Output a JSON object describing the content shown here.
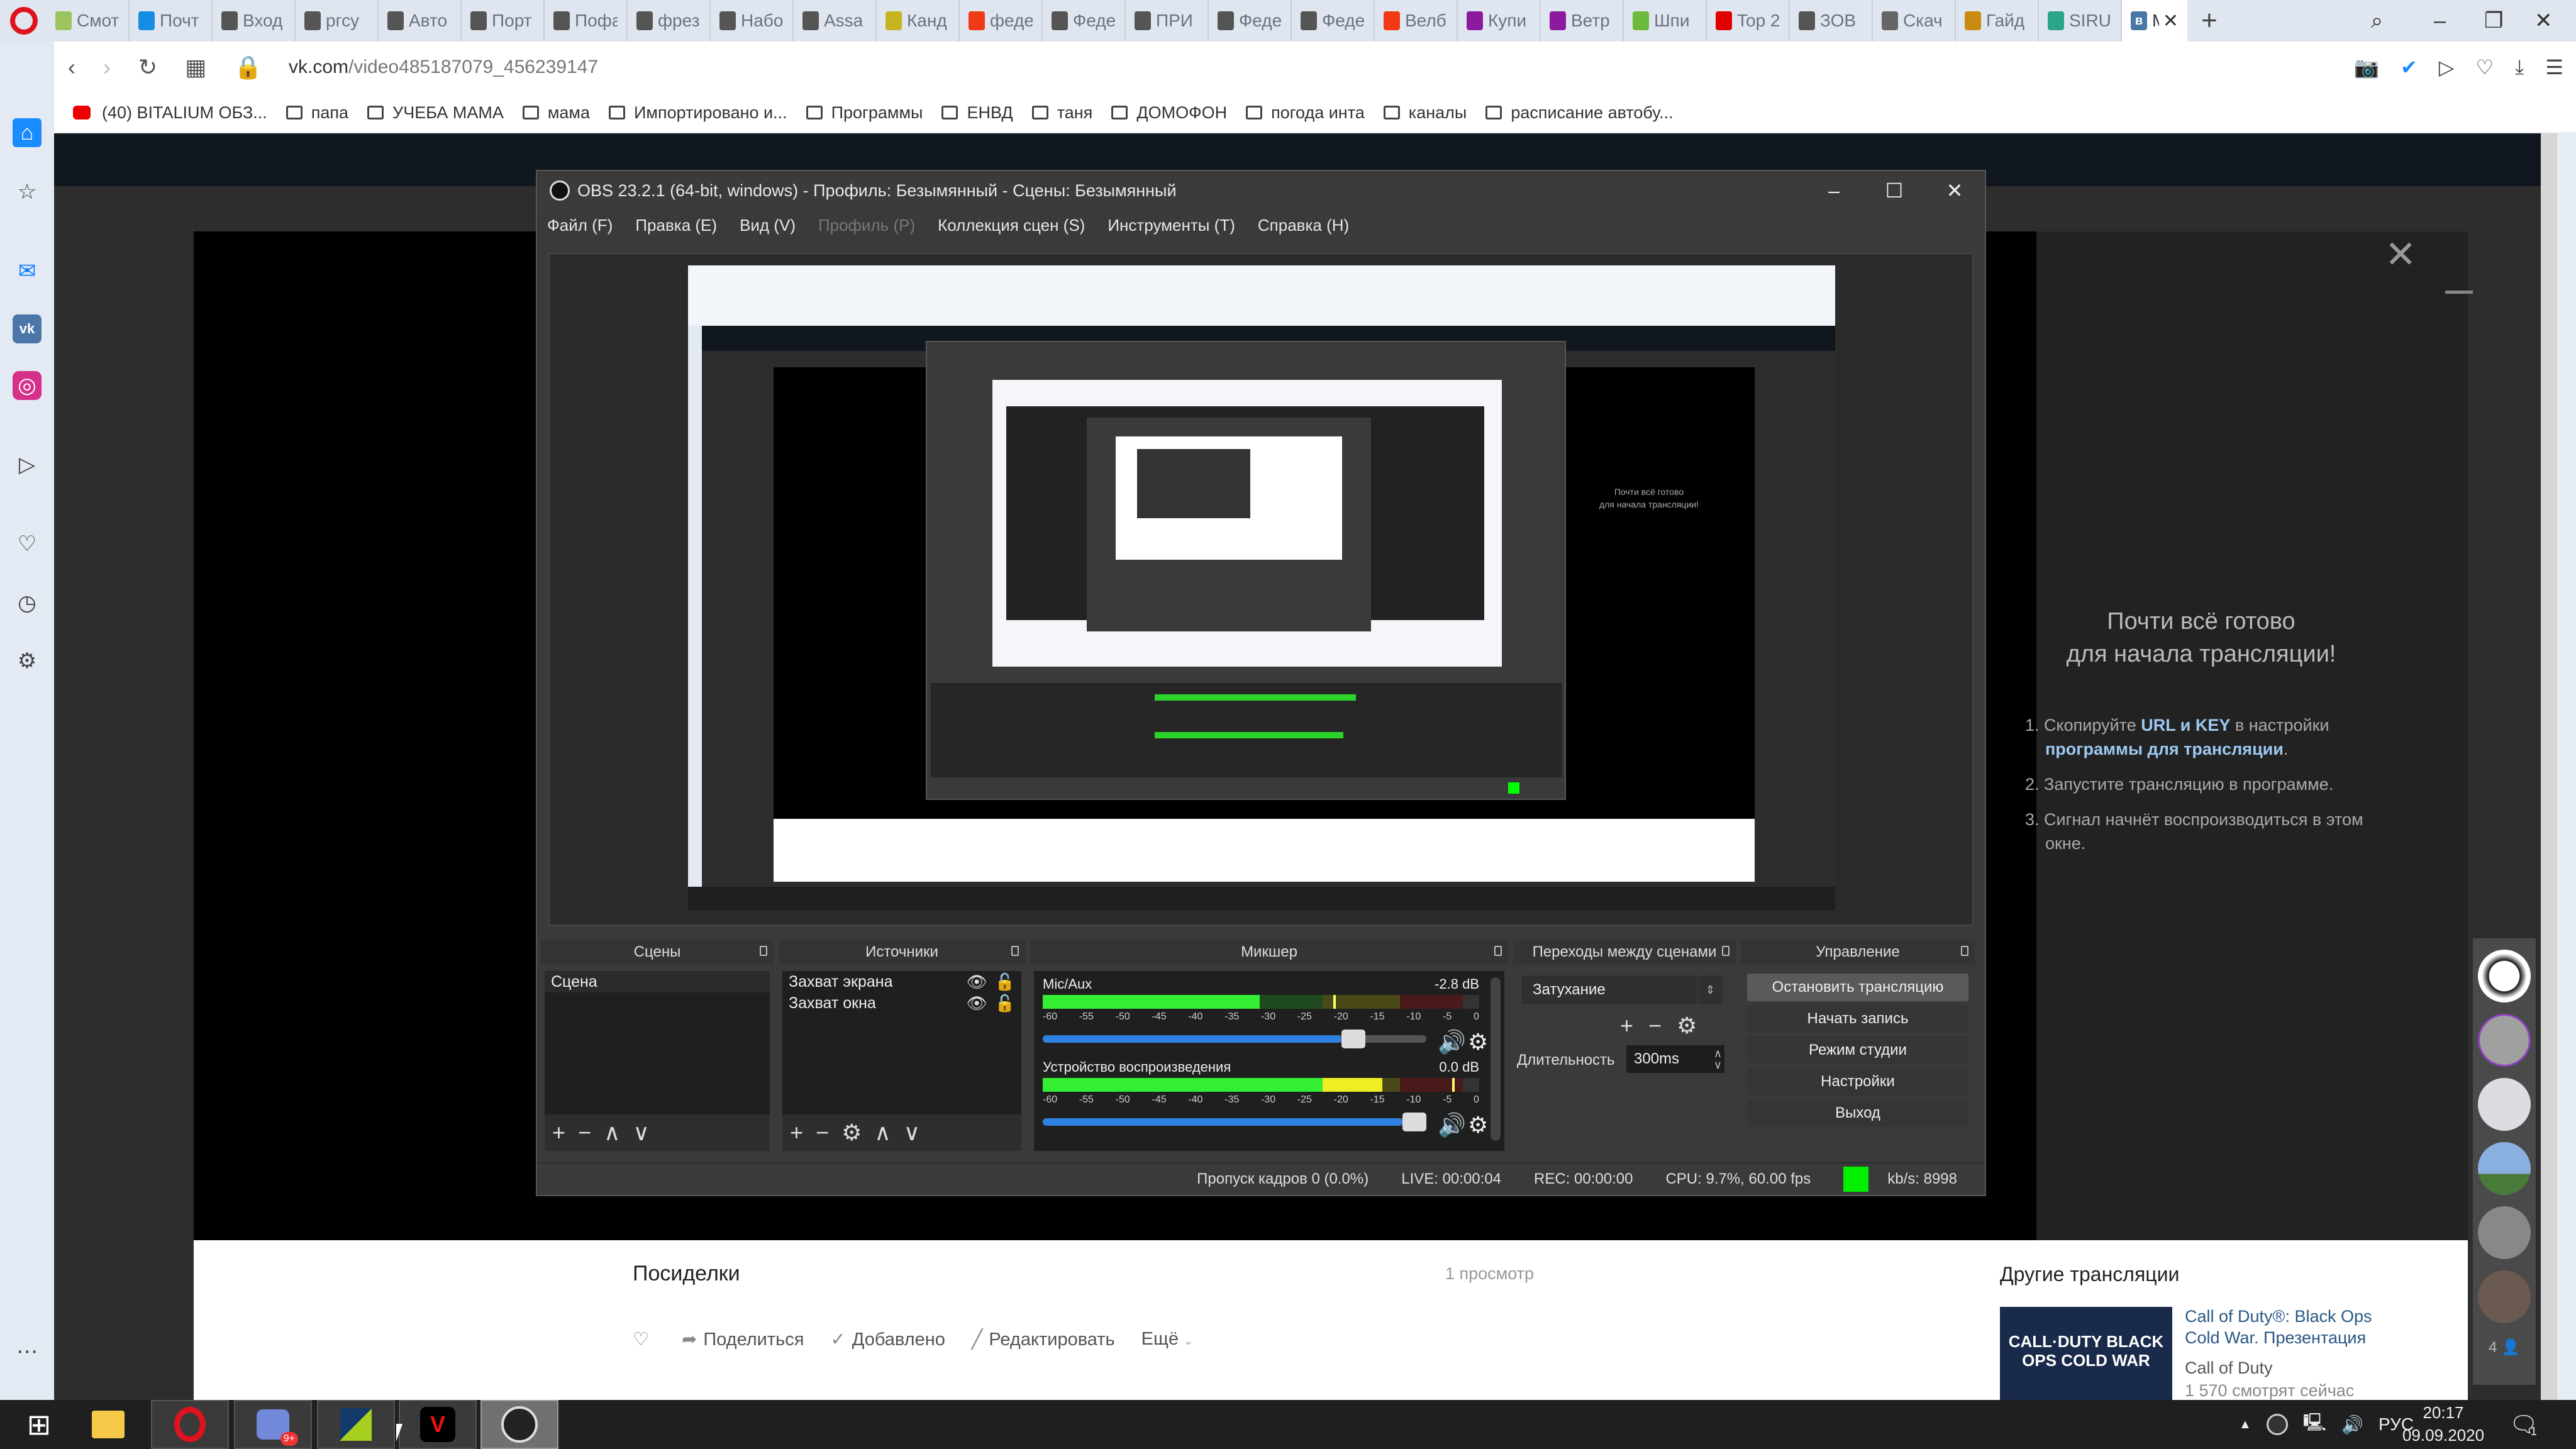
{
  "browser": {
    "tabs": [
      {
        "label": "Смот",
        "icon": "smotret-favicon",
        "color": "#9bc45a"
      },
      {
        "label": "Почт",
        "icon": "mail-ru-favicon",
        "color": "#168de2"
      },
      {
        "label": "Вход",
        "icon": "document-icon",
        "color": "#555555"
      },
      {
        "label": "ргсу",
        "icon": "document-icon",
        "color": "#555555"
      },
      {
        "label": "Авто",
        "icon": "document-icon",
        "color": "#555555"
      },
      {
        "label": "Порт",
        "icon": "document-icon",
        "color": "#555555"
      },
      {
        "label": "Пофа",
        "icon": "document-icon",
        "color": "#555555"
      },
      {
        "label": "фрез",
        "icon": "document-icon",
        "color": "#555555"
      },
      {
        "label": "Набо",
        "icon": "document-icon",
        "color": "#555555"
      },
      {
        "label": "Assa",
        "icon": "document-icon",
        "color": "#555555"
      },
      {
        "label": "Канд",
        "icon": "star-favicon",
        "color": "#c8b420"
      },
      {
        "label": "феде",
        "icon": "yandex-icon",
        "color": "#f03a17"
      },
      {
        "label": "Феде",
        "icon": "document-icon",
        "color": "#555555"
      },
      {
        "label": "ПРИ",
        "icon": "document-icon",
        "color": "#555555"
      },
      {
        "label": "Феде",
        "icon": "document-icon",
        "color": "#555555"
      },
      {
        "label": "Феде",
        "icon": "document-icon",
        "color": "#555555"
      },
      {
        "label": "Велб",
        "icon": "yandex-icon",
        "color": "#f03a17"
      },
      {
        "label": "Купи",
        "icon": "wildberries-icon",
        "color": "#8b1a9e"
      },
      {
        "label": "Ветр",
        "icon": "wildberries-icon",
        "color": "#8b1a9e"
      },
      {
        "label": "Шпи",
        "icon": "hd-icon",
        "color": "#6dbb3c"
      },
      {
        "label": "Top 2",
        "icon": "youtube-icon",
        "color": "#e00000"
      },
      {
        "label": "ЗОВ",
        "icon": "document-icon",
        "color": "#555555"
      },
      {
        "label": "Скач",
        "icon": "disc-icon",
        "color": "#666666"
      },
      {
        "label": "Гайд",
        "icon": "guide-favicon",
        "color": "#c88a10"
      },
      {
        "label": "SIRU",
        "icon": "siru-favicon",
        "color": "#2aa58a"
      }
    ],
    "active_tab": {
      "label": "М",
      "icon": "vk-icon",
      "color": "#4a76a8"
    },
    "url_host": "vk.com",
    "url_path": "/video485187079_456239147",
    "bookmarks": [
      {
        "label": "(40) BITALIUM ОБЗ...",
        "type": "youtube"
      },
      {
        "label": "папа",
        "type": "folder"
      },
      {
        "label": "УЧЕБА МАМА",
        "type": "folder"
      },
      {
        "label": "мама",
        "type": "folder"
      },
      {
        "label": "Импортировано и...",
        "type": "folder"
      },
      {
        "label": "Программы",
        "type": "folder"
      },
      {
        "label": "ЕНВД",
        "type": "folder"
      },
      {
        "label": "таня",
        "type": "folder"
      },
      {
        "label": "ДОМОФОН",
        "type": "folder"
      },
      {
        "label": "погода инта",
        "type": "folder"
      },
      {
        "label": "каналы",
        "type": "folder"
      },
      {
        "label": "расписание автобу...",
        "type": "folder"
      }
    ]
  },
  "obs": {
    "title": "OBS 23.2.1 (64-bit, windows) - Профиль: Безымянный - Сцены: Безымянный",
    "menu": [
      {
        "label": "Файл (F)",
        "disabled": false
      },
      {
        "label": "Правка (E)",
        "disabled": false
      },
      {
        "label": "Вид (V)",
        "disabled": false
      },
      {
        "label": "Профиль (P)",
        "disabled": true
      },
      {
        "label": "Коллекция сцен (S)",
        "disabled": false
      },
      {
        "label": "Инструменты (T)",
        "disabled": false
      },
      {
        "label": "Справка (H)",
        "disabled": false
      }
    ],
    "docks": {
      "scenes": {
        "title": "Сцены",
        "items": [
          "Сцена"
        ]
      },
      "sources": {
        "title": "Источники",
        "items": [
          "Захват экрана",
          "Захват окна"
        ]
      },
      "mixer": {
        "title": "Микшер",
        "ticks": [
          "-60",
          "-55",
          "-50",
          "-45",
          "-40",
          "-35",
          "-30",
          "-25",
          "-20",
          "-15",
          "-10",
          "-5",
          "0"
        ],
        "channels": [
          {
            "name": "Mic/Aux",
            "db": "-2.8 dB",
            "level_db": -29,
            "peak_db": -18.5,
            "volume": 0.83
          },
          {
            "name": "Устройство воспроизведения",
            "db": "0.0 dB",
            "level_db": -11.5,
            "peak_db": -1.5,
            "volume": 1.0
          }
        ]
      },
      "transitions": {
        "title": "Переходы между сценами",
        "selected": "Затухание",
        "duration_label": "Длительность",
        "duration": "300ms"
      },
      "controls": {
        "title": "Управление",
        "buttons": [
          "Остановить трансляцию",
          "Начать запись",
          "Режим студии",
          "Настройки",
          "Выход"
        ]
      }
    },
    "status": {
      "dropped": "Пропуск кадров 0 (0.0%)",
      "live": "LIVE: 00:00:04",
      "rec": "REC: 00:00:00",
      "cpu": "CPU: 9.7%, 60.00 fps",
      "bitrate": "kb/s: 8998",
      "health_color": "#00f000"
    }
  },
  "vk": {
    "info_heading_line1": "Почти всё готово",
    "info_heading_line2": "для начала трансляции!",
    "steps": {
      "s1_prefix": "1. Скопируйте ",
      "s1_link1": "URL и KEY",
      "s1_mid": " в настройки ",
      "s1_link2": "программы для трансляции",
      "s1_suffix": ".",
      "s2": "2. Запустите трансляцию в программе.",
      "s3": "3. Сигнал начнёт воспроизводиться в этом окне."
    },
    "video_title": "Посиделки",
    "views": "1 просмотр",
    "actions": {
      "share": "Поделиться",
      "added": "Добавлено",
      "edit": "Редактировать",
      "more": "Ещё"
    },
    "other_streams": {
      "title": "Другие трансляции",
      "thumb_text": "CALL·DUTY BLACK OPS COLD WAR",
      "item_title": "Call of Duty®: Black Ops Cold War. Презентация",
      "item_author": "Call of Duty",
      "item_count": "1 570 смотрят сейчас"
    },
    "viewer_count": "4"
  },
  "taskbar": {
    "apps": [
      "windows-start",
      "file-explorer",
      "opera",
      "discord",
      "app-blue-green",
      "vegas-app",
      "obs"
    ],
    "discord_badge": "9+",
    "language": "РУС",
    "time": "20:17",
    "date": "09.09.2020",
    "notifications": "1"
  }
}
